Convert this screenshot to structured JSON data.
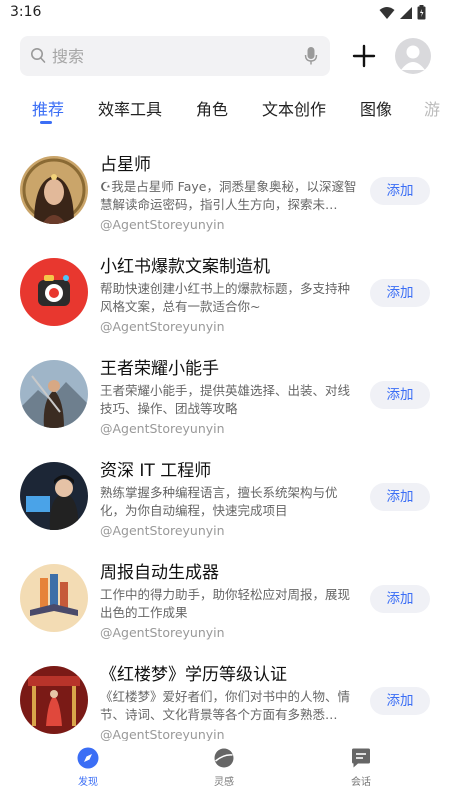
{
  "status_bar": {
    "time": "3:16",
    "icons": [
      "wifi-icon",
      "cell-signal-icon",
      "battery-icon"
    ]
  },
  "search": {
    "placeholder": "搜索",
    "icon": "search-icon",
    "voice_icon": "mic-icon"
  },
  "header": {
    "add_icon": "plus-icon",
    "avatar_icon": "user-avatar-icon"
  },
  "tabs": [
    {
      "label": "推荐",
      "active": true
    },
    {
      "label": "效率工具",
      "active": false
    },
    {
      "label": "角色",
      "active": false
    },
    {
      "label": "文本创作",
      "active": false
    },
    {
      "label": "图像",
      "active": false
    },
    {
      "label": "游",
      "active": false
    }
  ],
  "agents": [
    {
      "title": "占星师",
      "description": "☪我是占星师 Faye，洞悉星象奥秘，以深邃智慧解读命运密码，指引人生方向，探索未…",
      "author": "@AgentStoreyunyin",
      "action": "添加"
    },
    {
      "title": "小红书爆款文案制造机",
      "description": "帮助快速创建小红书上的爆款标题，多支持种风格文案，总有一款适合你~",
      "author": "@AgentStoreyunyin",
      "action": "添加"
    },
    {
      "title": "王者荣耀小能手",
      "description": "王者荣耀小能手，提供英雄选择、出装、对线技巧、操作、团战等攻略",
      "author": "@AgentStoreyunyin",
      "action": "添加"
    },
    {
      "title": "资深 IT 工程师",
      "description": "熟练掌握多种编程语言，擅长系统架构与优化，为你自动编程，快速完成项目",
      "author": "@AgentStoreyunyin",
      "action": "添加"
    },
    {
      "title": "周报自动生成器",
      "description": "工作中的得力助手，助你轻松应对周报，展现出色的工作成果",
      "author": "@AgentStoreyunyin",
      "action": "添加"
    },
    {
      "title": "《红楼梦》学历等级认证",
      "description": "《红楼梦》爱好者们，你们对书中的人物、情节、诗词、文化背景等各个方面有多熟悉…",
      "author": "@AgentStoreyunyin",
      "action": "添加"
    }
  ],
  "bottom_nav": [
    {
      "label": "发现",
      "icon": "compass-icon",
      "active": true
    },
    {
      "label": "灵感",
      "icon": "planet-icon",
      "active": false
    },
    {
      "label": "会话",
      "icon": "chat-icon",
      "active": false
    }
  ],
  "colors": {
    "accent": "#3b6ef5",
    "button_bg": "#f0f1f6",
    "search_bg": "#f2f2f4"
  }
}
